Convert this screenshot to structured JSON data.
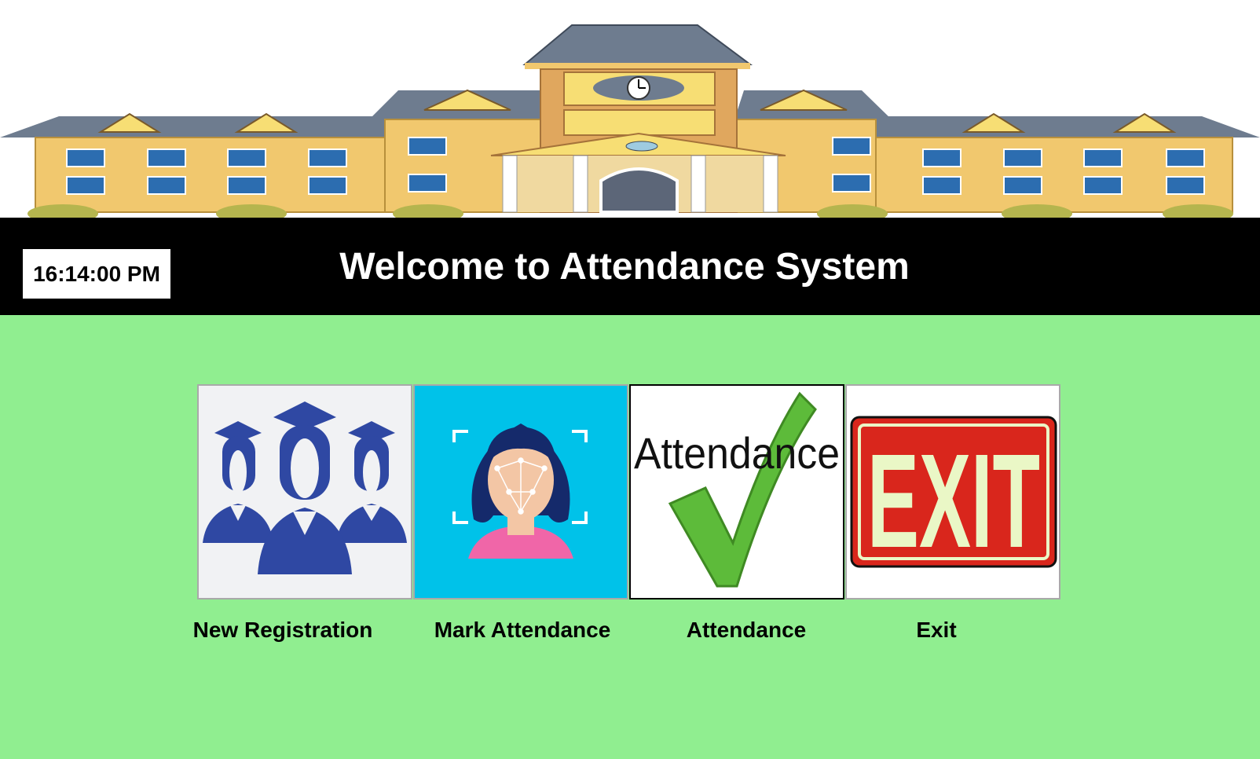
{
  "banner": {
    "image_name": "school-building-illustration"
  },
  "header": {
    "clock_text": "16:14:00 PM",
    "title": "Welcome to Attendance System"
  },
  "tiles": [
    {
      "id": "new-registration",
      "icon": "graduates-group-icon",
      "caption": "New Registration",
      "bg": "#f1f2f4"
    },
    {
      "id": "mark-attendance",
      "icon": "face-recognition-icon",
      "caption": "Mark Attendance",
      "bg": "#00c2e9"
    },
    {
      "id": "attendance",
      "icon": "attendance-checkmark-icon",
      "image_text": "Attendance",
      "caption": "Attendance",
      "bg": "#ffffff"
    },
    {
      "id": "exit",
      "icon": "exit-sign-icon",
      "image_text": "EXIT",
      "caption": "Exit",
      "bg": "#ffffff"
    }
  ],
  "colors": {
    "page_background": "#90ee90",
    "header_background": "#000000",
    "header_text": "#ffffff",
    "registration_icon": "#2f48a3",
    "exit_red": "#d9261c",
    "exit_letters": "#eaf7c6",
    "check_green": "#5dbb3a"
  }
}
